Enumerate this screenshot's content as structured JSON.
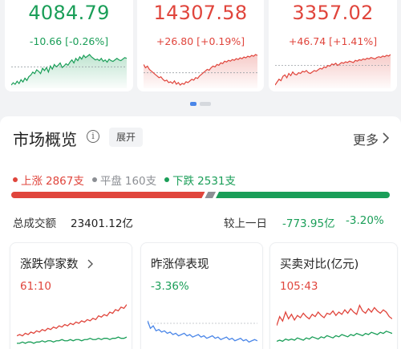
{
  "indices": [
    {
      "value": "4084.79",
      "change": "-10.66 [-0.26%]",
      "trend": "down",
      "spark": [
        5,
        8,
        6,
        10,
        7,
        12,
        9,
        14,
        11,
        16,
        18,
        22,
        20,
        25,
        23,
        20,
        27,
        24,
        28,
        22,
        30,
        26,
        32,
        29,
        31,
        34,
        28,
        30,
        33,
        31,
        35,
        38,
        34,
        40,
        37,
        42,
        39,
        44,
        41,
        43,
        45,
        42,
        40,
        38,
        39,
        37,
        40,
        36,
        38,
        35,
        39,
        37,
        36,
        38,
        40,
        38,
        37,
        39,
        41,
        40
      ],
      "ref": 0.42
    },
    {
      "value": "14307.58",
      "change": "+26.80 [+0.19%]",
      "trend": "up",
      "spark": [
        30,
        26,
        28,
        24,
        22,
        20,
        18,
        16,
        14,
        15,
        12,
        10,
        11,
        8,
        9,
        7,
        10,
        6,
        8,
        5,
        7,
        6,
        9,
        8,
        10,
        12,
        11,
        14,
        13,
        16,
        18,
        20,
        22,
        24,
        23,
        26,
        28,
        27,
        30,
        29,
        32,
        31,
        34,
        33,
        35,
        34,
        36,
        35,
        37,
        36,
        38,
        37,
        39,
        38,
        40,
        39,
        41,
        40,
        42,
        41
      ],
      "ref": 0.58
    },
    {
      "value": "3357.02",
      "change": "+46.74 [+1.41%]",
      "trend": "up",
      "spark": [
        6,
        10,
        14,
        12,
        18,
        20,
        16,
        22,
        19,
        24,
        21,
        20,
        23,
        22,
        25,
        24,
        26,
        23,
        22,
        24,
        26,
        25,
        27,
        29,
        28,
        31,
        30,
        33,
        32,
        35,
        34,
        36,
        33,
        35,
        37,
        36,
        38,
        37,
        39,
        38,
        37,
        40,
        39,
        41,
        40,
        42,
        41,
        43,
        42,
        44,
        43,
        42,
        44,
        45,
        44,
        46,
        45,
        47,
        46,
        48
      ],
      "ref": 0.38
    }
  ],
  "panel": {
    "title": "市场概览",
    "info_icon": "info-icon",
    "expand_label": "展开",
    "more_label": "更多"
  },
  "breadth": {
    "up_label": "上涨",
    "up_count": "2867支",
    "flat_label": "平盘",
    "flat_count": "160支",
    "down_label": "下跌",
    "down_count": "2531支",
    "up": 2867,
    "flat": 160,
    "down": 2531
  },
  "turnover": {
    "label": "总成交额",
    "value": "23401.12亿",
    "compare_label": "较上一日",
    "compare_value": "-773.95亿",
    "compare_pct": "-3.20%"
  },
  "cards": [
    {
      "title": "涨跌停家数",
      "value": "61:10",
      "value_color": "red",
      "red": [
        8,
        9,
        8,
        10,
        9,
        11,
        10,
        12,
        11,
        13,
        12,
        14,
        13,
        15,
        14,
        16,
        15,
        17,
        16,
        18,
        17,
        19,
        18,
        20,
        19,
        21,
        20,
        22,
        21,
        24,
        23,
        25,
        24,
        27,
        26,
        29,
        28,
        31,
        30,
        33
      ],
      "green": [
        2,
        2,
        3,
        2,
        3,
        3,
        2,
        3,
        3,
        4,
        3,
        4,
        4,
        3,
        4,
        4,
        5,
        4,
        4,
        5,
        4,
        5,
        5,
        4,
        5,
        5,
        6,
        5,
        5,
        6,
        5,
        6,
        6,
        5,
        6,
        6,
        7,
        6,
        6,
        7
      ]
    },
    {
      "title": "昨涨停表现",
      "value": "-3.36%",
      "value_color": "green",
      "blue": [
        20,
        14,
        16,
        12,
        13,
        11,
        12,
        10,
        11,
        9,
        10,
        8,
        9,
        10,
        8,
        9,
        7,
        8,
        9,
        7,
        8,
        6,
        7,
        8,
        6,
        7,
        5,
        6,
        7,
        5,
        6,
        4,
        5,
        6,
        4,
        5,
        3,
        4,
        5,
        4
      ]
    },
    {
      "title": "买卖对比(亿元)",
      "value": "105:43",
      "value_color": "red",
      "red": [
        18,
        26,
        22,
        30,
        24,
        28,
        23,
        27,
        25,
        29,
        26,
        24,
        28,
        26,
        30,
        27,
        25,
        29,
        28,
        31,
        27,
        30,
        28,
        32,
        29,
        33,
        30,
        28,
        36,
        31,
        29,
        33,
        30,
        34,
        31,
        29,
        32,
        30,
        26,
        24
      ],
      "green": [
        4,
        5,
        4,
        6,
        5,
        6,
        5,
        7,
        6,
        5,
        7,
        6,
        8,
        7,
        6,
        8,
        7,
        9,
        8,
        7,
        9,
        8,
        10,
        9,
        8,
        10,
        9,
        11,
        10,
        9,
        11,
        10,
        12,
        11,
        10,
        12,
        11,
        13,
        12,
        11
      ]
    }
  ],
  "colors": {
    "red": "#e0453c",
    "green": "#1a9e58",
    "gray": "#8c8f94",
    "blue": "#4a86e8"
  }
}
